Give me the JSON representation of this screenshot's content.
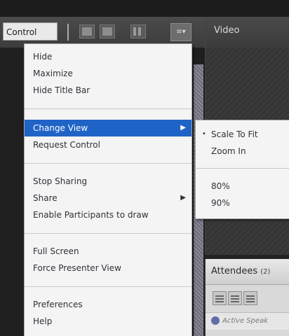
{
  "left_pod": {
    "control_label": "Control",
    "menu_button_glyph": "≡▾"
  },
  "video_pod": {
    "title": "Video"
  },
  "attendees_pod": {
    "title": "Attendees",
    "count": "(2)",
    "active_speakers_label": "Active Speak"
  },
  "main_menu": {
    "items": [
      {
        "label": "Hide"
      },
      {
        "label": "Maximize"
      },
      {
        "label": "Hide Title Bar"
      },
      {
        "label": "Change View",
        "submenu": true,
        "highlighted": true
      },
      {
        "label": "Request Control"
      },
      {
        "label": "Stop Sharing"
      },
      {
        "label": "Share",
        "submenu": true
      },
      {
        "label": "Enable Participants to draw"
      },
      {
        "label": "Full Screen"
      },
      {
        "label": "Force Presenter View"
      },
      {
        "label": "Preferences"
      },
      {
        "label": "Help"
      }
    ],
    "submenu_arrow": "▶"
  },
  "change_view_submenu": {
    "items": [
      {
        "label": "Scale To Fit",
        "selected": true
      },
      {
        "label": "Zoom In"
      },
      {
        "label": "80%"
      },
      {
        "label": "90%"
      }
    ],
    "selected_marker": "•"
  },
  "colors": {
    "highlight": "#1f63c6",
    "menu_background": "#f4f4f4",
    "menu_text": "#2f3138"
  }
}
